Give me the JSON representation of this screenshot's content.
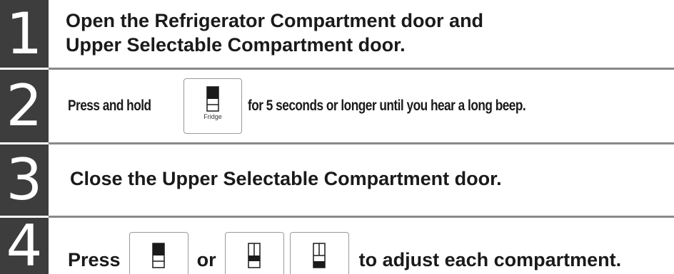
{
  "steps": [
    {
      "number": "1",
      "lines": [
        "Open the Refrigerator Compartment door and",
        "Upper Selectable Compartment door."
      ]
    },
    {
      "number": "2",
      "text_before": "Press and hold",
      "text_after": "for 5 seconds or longer until you hear a long beep.",
      "button": {
        "icon": "fridge-upper-dark-icon",
        "label": "Fridge"
      }
    },
    {
      "number": "3",
      "text": "Close the Upper Selectable Compartment door."
    },
    {
      "number": "4",
      "word_press": "Press",
      "word_or": "or",
      "text_after": "to adjust each compartment.",
      "buttons": [
        {
          "icon": "upper-compartment-dark-icon"
        },
        {
          "icon": "middle-compartment-dark-icon"
        },
        {
          "icon": "lower-compartment-dark-icon"
        }
      ]
    }
  ],
  "colors": {
    "number_bg": "#3d3d3d",
    "number_fg": "#ffffff",
    "separator": "#888888",
    "icon_fill": "#1a1a1a"
  }
}
